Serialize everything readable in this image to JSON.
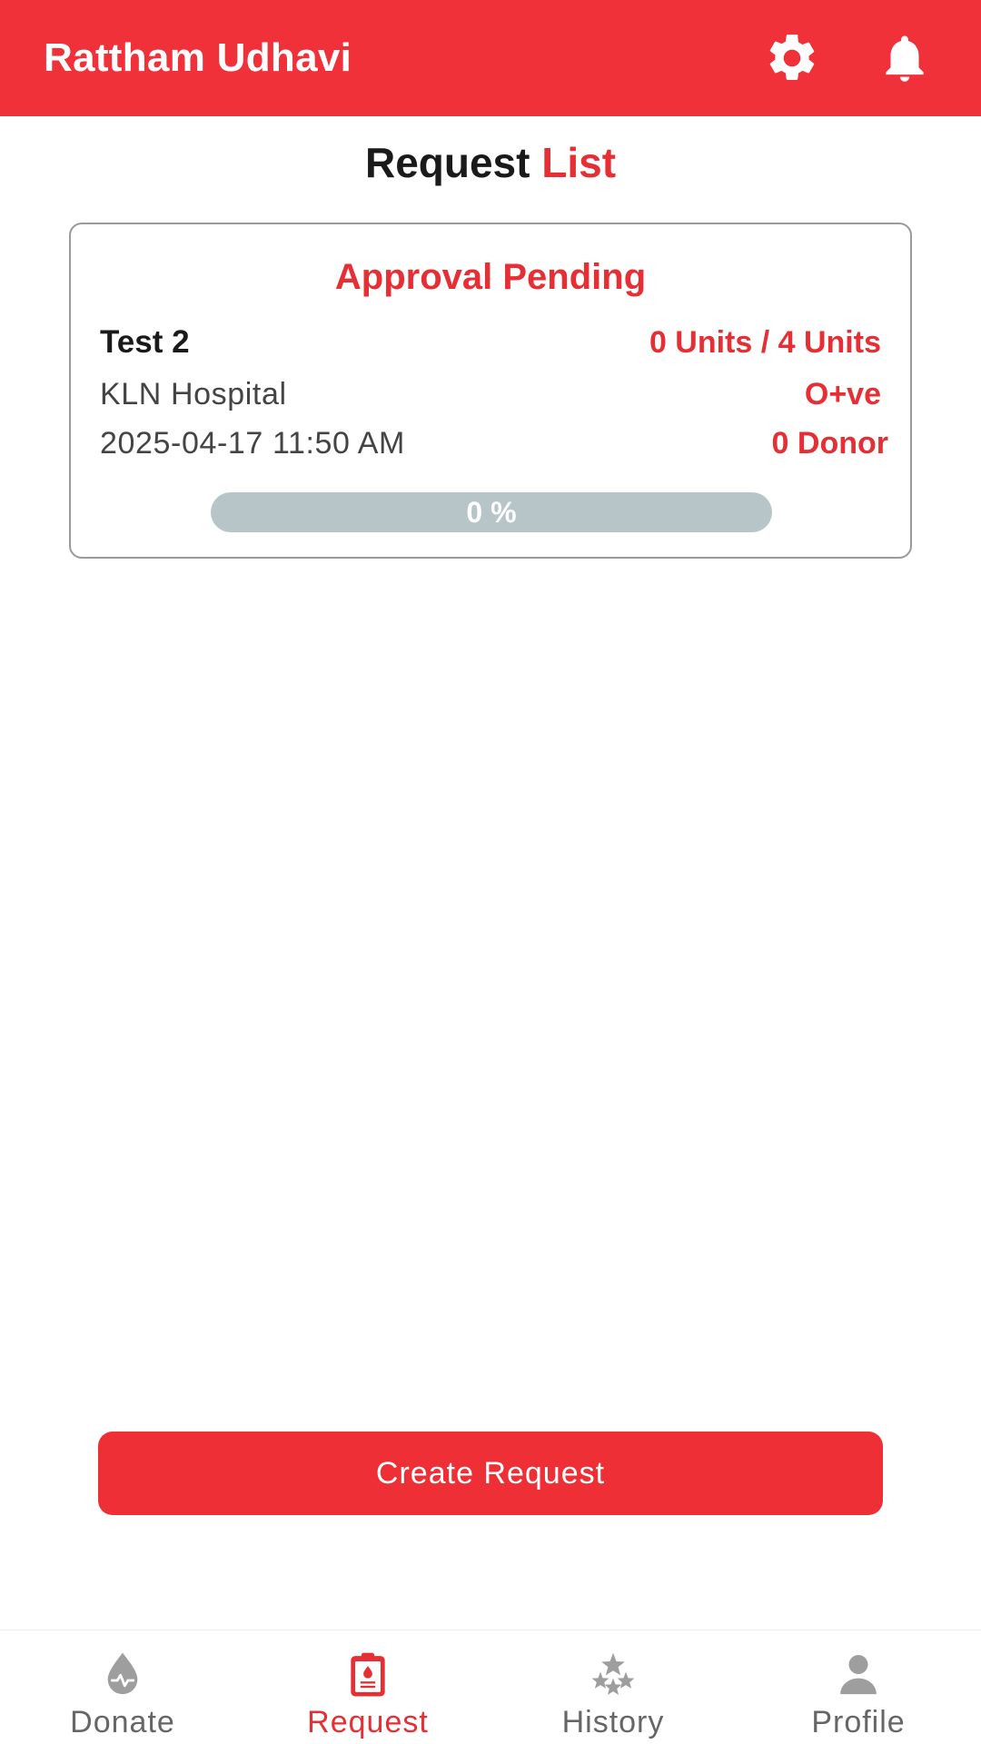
{
  "header": {
    "title": "Rattham Udhavi",
    "settings_icon": "gear-icon",
    "notifications_icon": "bell-icon"
  },
  "page_title": {
    "part1": "Request",
    "part2": "List"
  },
  "requests": [
    {
      "status": "Approval Pending",
      "name": "Test 2",
      "units": "0 Units / 4 Units",
      "hospital": "KLN Hospital",
      "blood_group": "O+ve",
      "datetime": "2025-04-17 11:50 AM",
      "donors": "0 Donor",
      "progress_label": "0 %",
      "progress_percent": 0
    }
  ],
  "create_button": {
    "label": "Create Request"
  },
  "bottom_nav": {
    "items": [
      {
        "label": "Donate",
        "icon": "blood-drop-icon"
      },
      {
        "label": "Request",
        "icon": "clipboard-icon"
      },
      {
        "label": "History",
        "icon": "stars-icon"
      },
      {
        "label": "Profile",
        "icon": "user-icon"
      }
    ],
    "active_index": 1
  },
  "colors": {
    "primary": "#f0313a",
    "accent_text": "#e62e35",
    "progress_track": "#b8c5c8",
    "inactive_nav": "#9e9e9e"
  }
}
